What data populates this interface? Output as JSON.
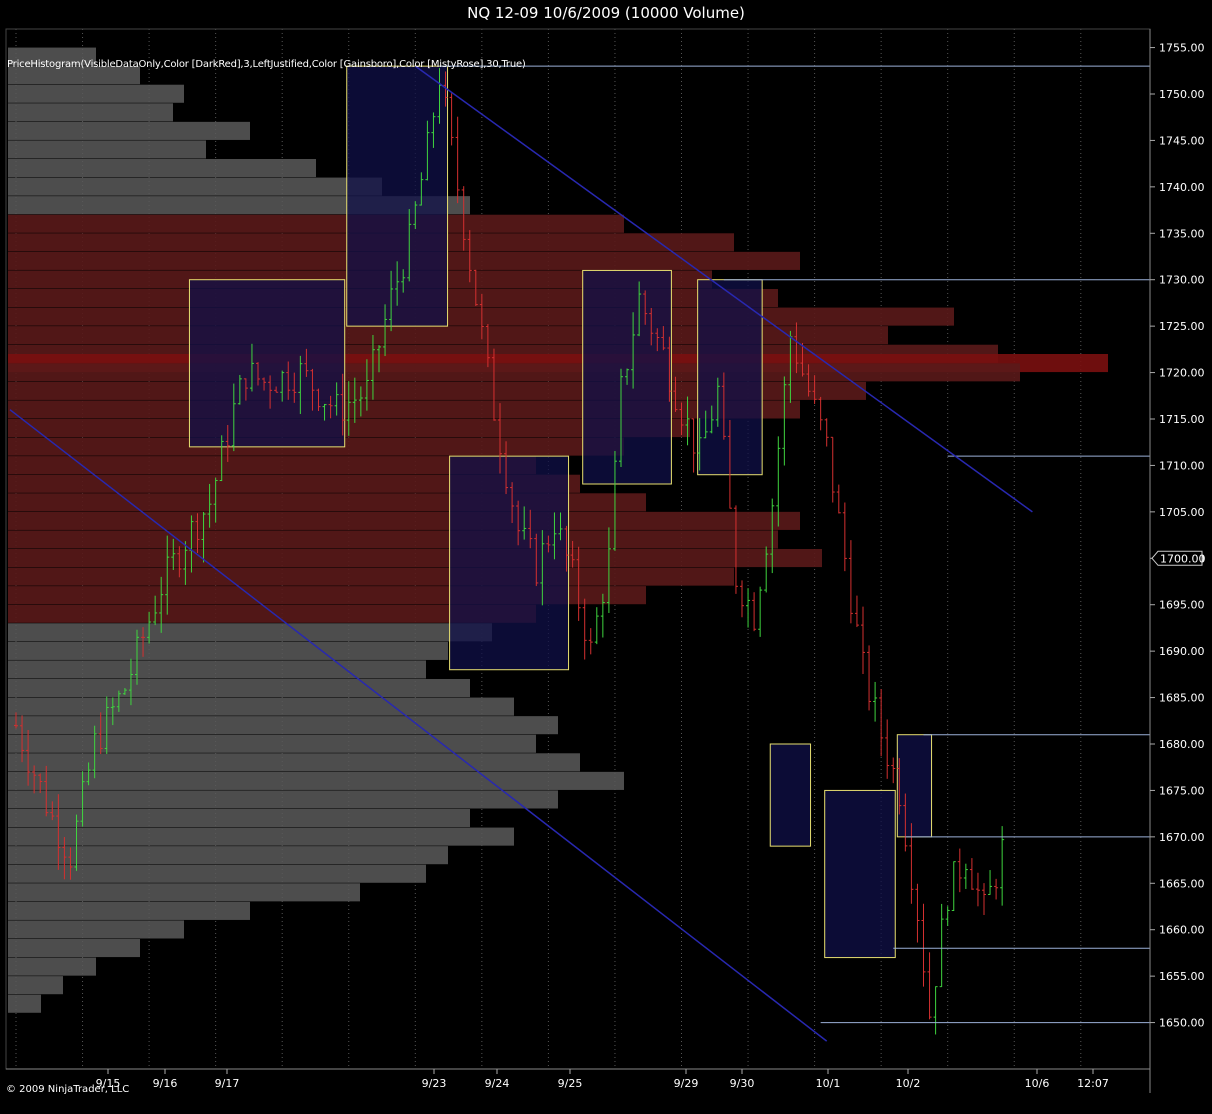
{
  "window": {
    "title": "NQ 12-09  10/6/2009 (10000 Volume)",
    "indicator": "PriceHistogram(VisibleDataOnly,Color [DarkRed],3,LeftJustified,Color [Gainsboro],Color [MistyRose],30,True)",
    "copyright": "© 2009 NinjaTrader, LLC"
  },
  "colors": {
    "background": "#000000",
    "up_bar": "#3fd43f",
    "down_bar": "#d43030",
    "histogram": "#5a5a5a",
    "value_area": "#5a1a1a",
    "box_fill": "#101048",
    "box_border": "#e8e070",
    "trend_line": "#2828b0",
    "level_line": "#9bb0d8",
    "axis_text": "#ffffff"
  },
  "chart_data": {
    "type": "candlestick_with_volume_profile",
    "title": "NQ 12-09  10/6/2009 (10000 Volume)",
    "ylim": [
      1645,
      1757
    ],
    "y_ticks": [
      1650,
      1655,
      1660,
      1665,
      1670,
      1675,
      1680,
      1685,
      1690,
      1695,
      1700,
      1705,
      1710,
      1715,
      1720,
      1725,
      1730,
      1735,
      1740,
      1745,
      1750,
      1755
    ],
    "y_tick_labels": [
      "1650.00",
      "1655.00",
      "1660.00",
      "1665.00",
      "1670.00",
      "1675.00",
      "1680.00",
      "1685.00",
      "1690.00",
      "1695.00",
      "1700.00",
      "1705.00",
      "1710.00",
      "1715.00",
      "1720.00",
      "1725.00",
      "1730.00",
      "1735.00",
      "1740.00",
      "1745.00",
      "1750.00",
      "1755.00"
    ],
    "last_price": 1700,
    "last_price_label": "1700.00",
    "x_labels": [
      "9/15",
      "9/16",
      "9/17",
      "9/23",
      "9/24",
      "9/25",
      "9/29",
      "9/30",
      "10/1",
      "10/2",
      "10/6",
      "12:07"
    ],
    "bar_count": 164,
    "price_path": [
      [
        0,
        1682
      ],
      [
        6,
        1672
      ],
      [
        9,
        1668
      ],
      [
        13,
        1680
      ],
      [
        18,
        1686
      ],
      [
        24,
        1697
      ],
      [
        28,
        1702
      ],
      [
        32,
        1706
      ],
      [
        36,
        1716
      ],
      [
        38,
        1720
      ],
      [
        41,
        1719
      ],
      [
        47,
        1720
      ],
      [
        53,
        1716
      ],
      [
        58,
        1718
      ],
      [
        62,
        1728
      ],
      [
        65,
        1734
      ],
      [
        68,
        1744
      ],
      [
        70,
        1752
      ],
      [
        73,
        1740
      ],
      [
        76,
        1728
      ],
      [
        79,
        1716
      ],
      [
        83,
        1703
      ],
      [
        86,
        1699
      ],
      [
        89,
        1704
      ],
      [
        92,
        1698
      ],
      [
        95,
        1690
      ],
      [
        98,
        1700
      ],
      [
        100,
        1718
      ],
      [
        103,
        1728
      ],
      [
        107,
        1722
      ],
      [
        110,
        1716
      ],
      [
        113,
        1711
      ],
      [
        116,
        1718
      ],
      [
        119,
        1698
      ],
      [
        122,
        1694
      ],
      [
        125,
        1706
      ],
      [
        128,
        1724
      ],
      [
        131,
        1718
      ],
      [
        134,
        1712
      ],
      [
        137,
        1700
      ],
      [
        140,
        1688
      ],
      [
        143,
        1681
      ],
      [
        146,
        1675
      ],
      [
        149,
        1662
      ],
      [
        151,
        1651
      ],
      [
        154,
        1664
      ],
      [
        157,
        1668
      ],
      [
        160,
        1662
      ],
      [
        162,
        1666
      ],
      [
        165,
        1674
      ],
      [
        168,
        1682
      ],
      [
        171,
        1700
      ],
      [
        174,
        1708
      ],
      [
        177,
        1700
      ],
      [
        179,
        1688
      ],
      [
        181,
        1700
      ],
      [
        183,
        1699
      ]
    ],
    "profile": [
      [
        1754,
        0.08
      ],
      [
        1752,
        0.12
      ],
      [
        1750,
        0.16
      ],
      [
        1748,
        0.15
      ],
      [
        1746,
        0.22
      ],
      [
        1744,
        0.18
      ],
      [
        1742,
        0.28
      ],
      [
        1740,
        0.34
      ],
      [
        1738,
        0.42
      ],
      [
        1736,
        0.56
      ],
      [
        1734,
        0.66
      ],
      [
        1732,
        0.72
      ],
      [
        1730,
        0.64
      ],
      [
        1728,
        0.7
      ],
      [
        1726,
        0.86
      ],
      [
        1724,
        0.8
      ],
      [
        1722,
        0.9
      ],
      [
        1721,
        1.0
      ],
      [
        1720,
        0.92
      ],
      [
        1718,
        0.78
      ],
      [
        1716,
        0.72
      ],
      [
        1714,
        0.62
      ],
      [
        1712,
        0.56
      ],
      [
        1710,
        0.48
      ],
      [
        1708,
        0.52
      ],
      [
        1706,
        0.58
      ],
      [
        1704,
        0.72
      ],
      [
        1702,
        0.7
      ],
      [
        1700,
        0.74
      ],
      [
        1698,
        0.66
      ],
      [
        1696,
        0.58
      ],
      [
        1694,
        0.48
      ],
      [
        1692,
        0.44
      ],
      [
        1690,
        0.4
      ],
      [
        1688,
        0.38
      ],
      [
        1686,
        0.42
      ],
      [
        1684,
        0.46
      ],
      [
        1682,
        0.5
      ],
      [
        1680,
        0.48
      ],
      [
        1678,
        0.52
      ],
      [
        1676,
        0.56
      ],
      [
        1674,
        0.5
      ],
      [
        1672,
        0.42
      ],
      [
        1670,
        0.46
      ],
      [
        1668,
        0.4
      ],
      [
        1666,
        0.38
      ],
      [
        1664,
        0.32
      ],
      [
        1662,
        0.22
      ],
      [
        1660,
        0.16
      ],
      [
        1658,
        0.12
      ],
      [
        1656,
        0.08
      ],
      [
        1654,
        0.05
      ],
      [
        1652,
        0.03
      ]
    ],
    "value_area": [
      1693,
      1736
    ],
    "poc": 1721,
    "boxes": [
      {
        "x0": 29,
        "x1": 54,
        "low": 1712,
        "high": 1730
      },
      {
        "x0": 55,
        "x1": 71,
        "low": 1725,
        "high": 1753
      },
      {
        "x0": 72,
        "x1": 91,
        "low": 1688,
        "high": 1711
      },
      {
        "x0": 94,
        "x1": 108,
        "low": 1708,
        "high": 1731
      },
      {
        "x0": 113,
        "x1": 123,
        "low": 1709,
        "high": 1730
      },
      {
        "x0": 125,
        "x1": 131,
        "low": 1669,
        "high": 1680
      },
      {
        "x0": 134,
        "x1": 145,
        "low": 1657,
        "high": 1675
      },
      {
        "x0": 146,
        "x1": 151,
        "low": 1670,
        "high": 1681
      }
    ],
    "level_lines": [
      {
        "x0": 70,
        "level": 1753
      },
      {
        "x0": 117,
        "level": 1730
      },
      {
        "x0": 154,
        "level": 1711
      },
      {
        "x0": 150,
        "level": 1681
      },
      {
        "x0": 147,
        "level": 1670
      },
      {
        "x0": 145,
        "level": 1658
      },
      {
        "x0": 133,
        "level": 1650
      }
    ],
    "trend_lines": [
      {
        "x0": -1,
        "y0": 1716,
        "x1": 134,
        "y1": 1648
      },
      {
        "x0": 66,
        "y0": 1753,
        "x1": 168,
        "y1": 1705
      }
    ],
    "grid": "vertical-dotted"
  }
}
